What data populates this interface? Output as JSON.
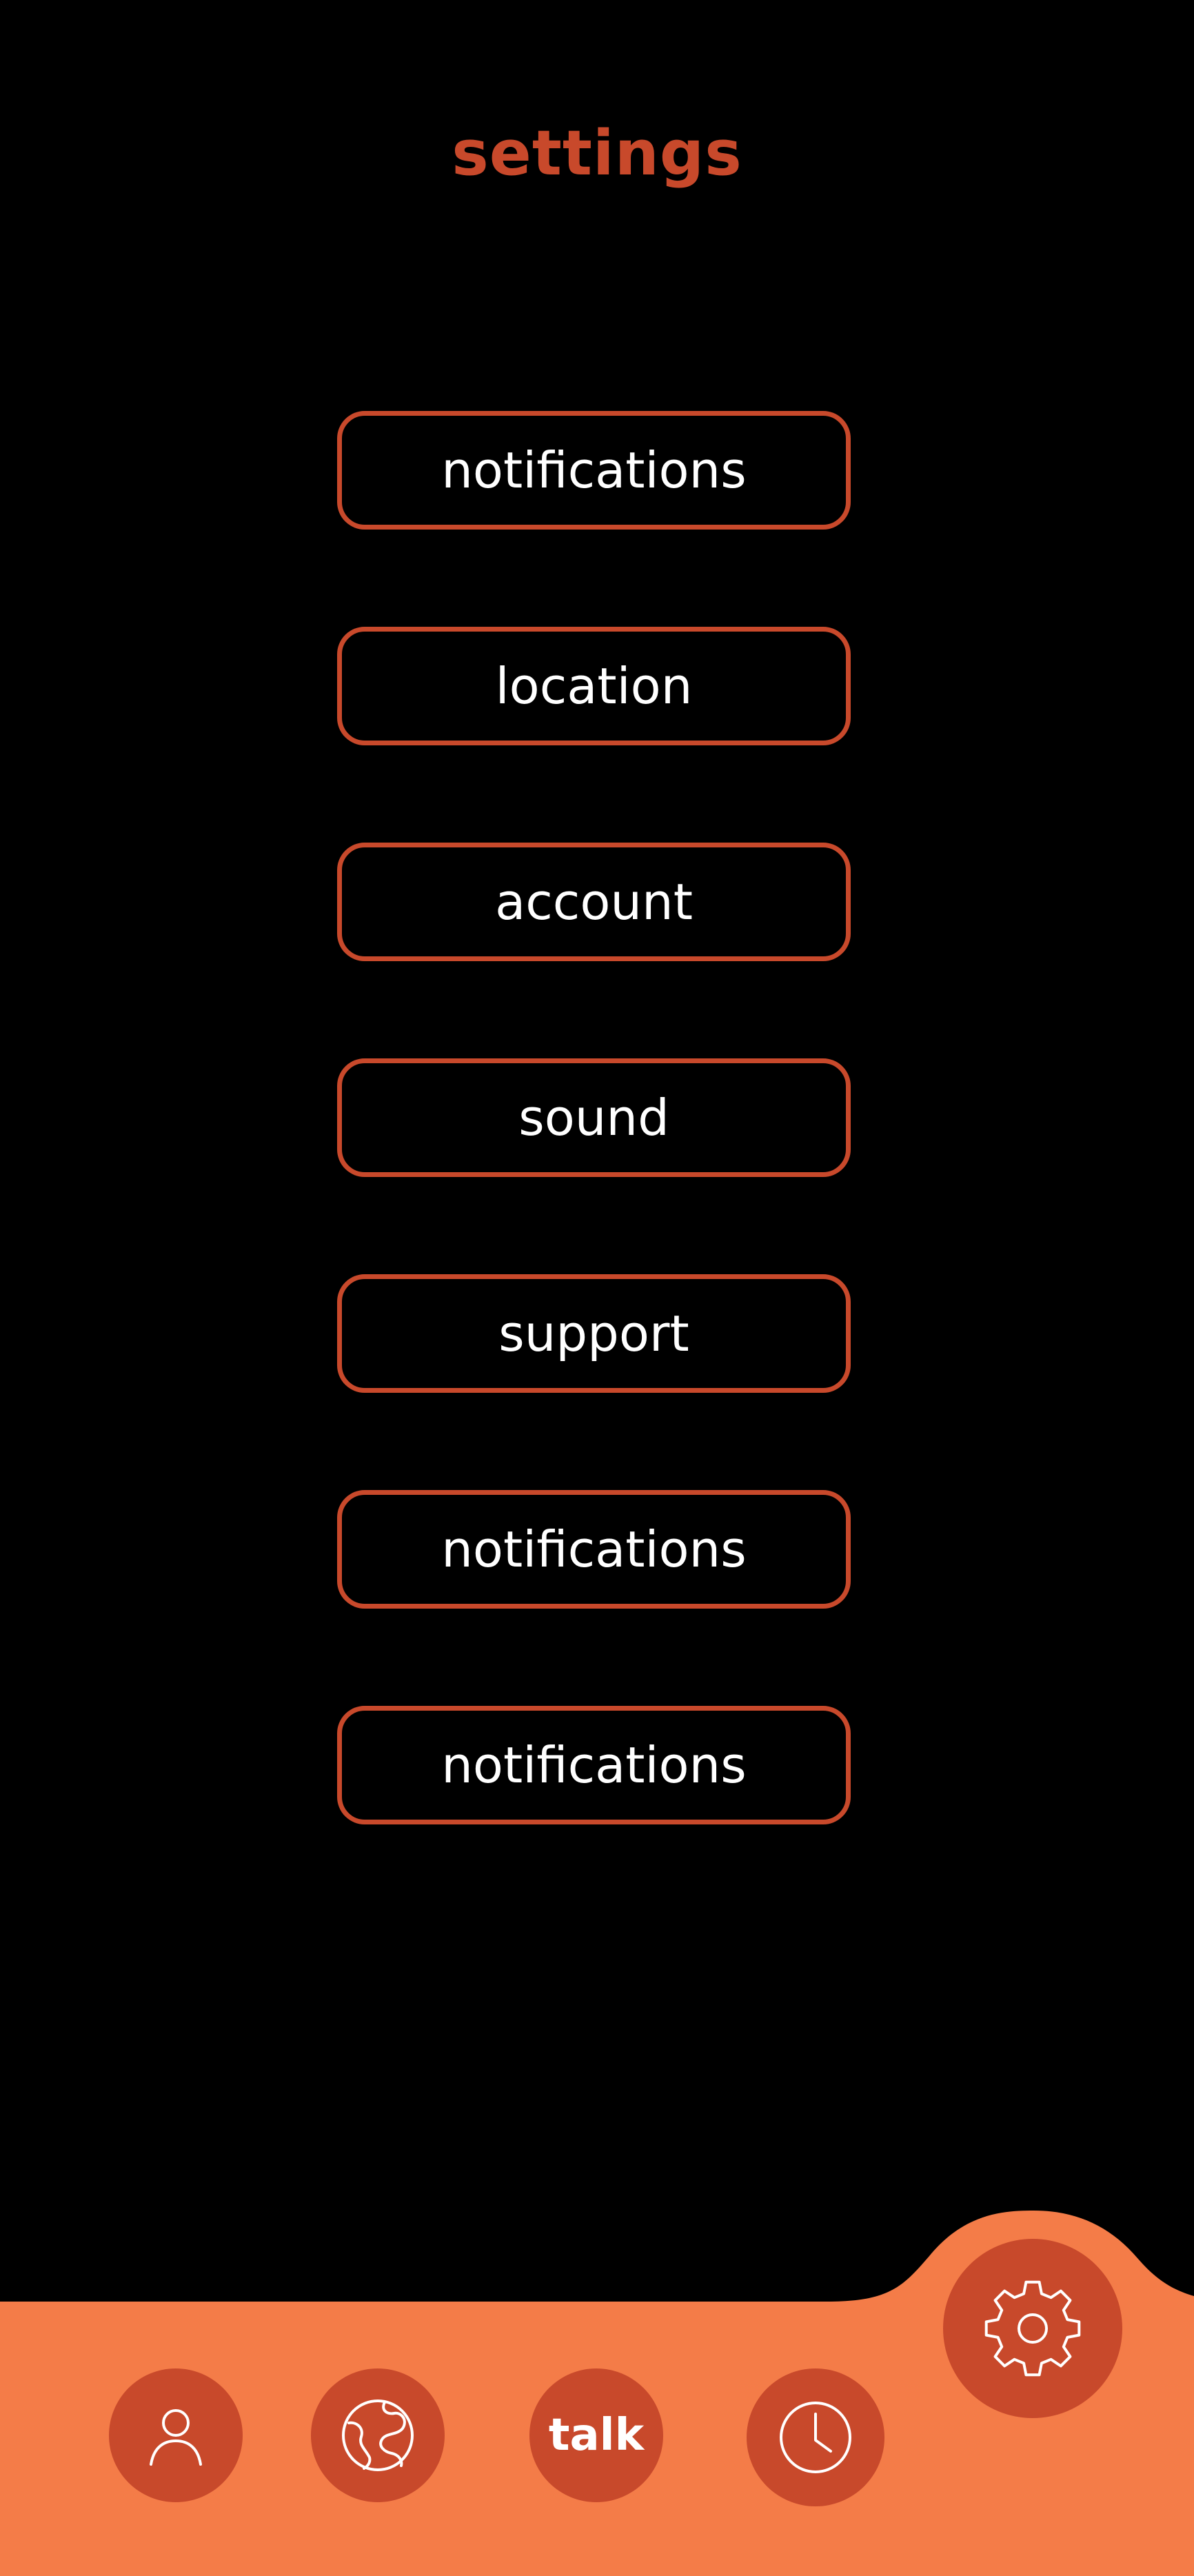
{
  "header": {
    "title": "settings"
  },
  "menu": {
    "items": [
      {
        "label": "notifications"
      },
      {
        "label": "location"
      },
      {
        "label": "account"
      },
      {
        "label": "sound"
      },
      {
        "label": "support"
      },
      {
        "label": "notifications"
      },
      {
        "label": "notifications"
      }
    ]
  },
  "tabbar": {
    "items": [
      {
        "icon": "profile-icon"
      },
      {
        "icon": "globe-icon"
      },
      {
        "label": "talk"
      },
      {
        "icon": "clock-icon"
      },
      {
        "icon": "gear-icon",
        "active": true
      }
    ]
  },
  "colors": {
    "background": "#000000",
    "accent": "#c8492b",
    "tabbar": "#f47c48",
    "text": "#ffffff"
  }
}
